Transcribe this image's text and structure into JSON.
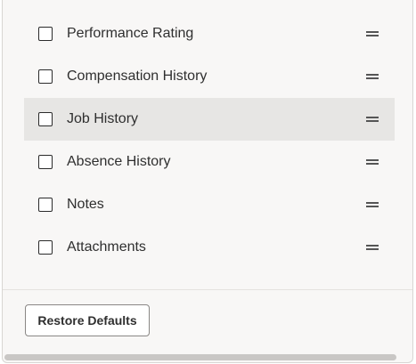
{
  "items": [
    {
      "label": "Performance Rating",
      "checked": false,
      "highlighted": false
    },
    {
      "label": "Compensation History",
      "checked": false,
      "highlighted": false
    },
    {
      "label": "Job History",
      "checked": false,
      "highlighted": true
    },
    {
      "label": "Absence History",
      "checked": false,
      "highlighted": false
    },
    {
      "label": "Notes",
      "checked": false,
      "highlighted": false
    },
    {
      "label": "Attachments",
      "checked": false,
      "highlighted": false
    }
  ],
  "footer": {
    "restore_label": "Restore Defaults"
  },
  "icons": {
    "drag": "drag-handle-icon"
  },
  "colors": {
    "highlight": "#e7e6e4",
    "panel": "#f8f7f6",
    "text": "#2f2f2f"
  }
}
